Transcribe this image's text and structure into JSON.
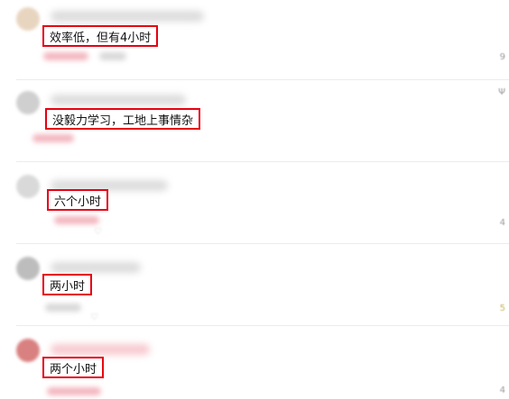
{
  "comments": [
    {
      "text": "效率低，但有4小时",
      "avatar_color": "#e8d5c0",
      "side": "9"
    },
    {
      "text": "没毅力学习，工地上事情杂",
      "avatar_color": "#cfcfcf",
      "side": "Ψ"
    },
    {
      "text": "六个小时",
      "avatar_color": "#d9d9d9",
      "side": "4"
    },
    {
      "text": "两小时",
      "avatar_color": "#bdbdbd",
      "side": "5"
    },
    {
      "text": "两个小时",
      "avatar_color": "#d98080",
      "side": "4"
    }
  ],
  "colors": {
    "highlight_border": "#e60012",
    "divider": "#ececec",
    "blur_pink": "#f3b6bf"
  }
}
